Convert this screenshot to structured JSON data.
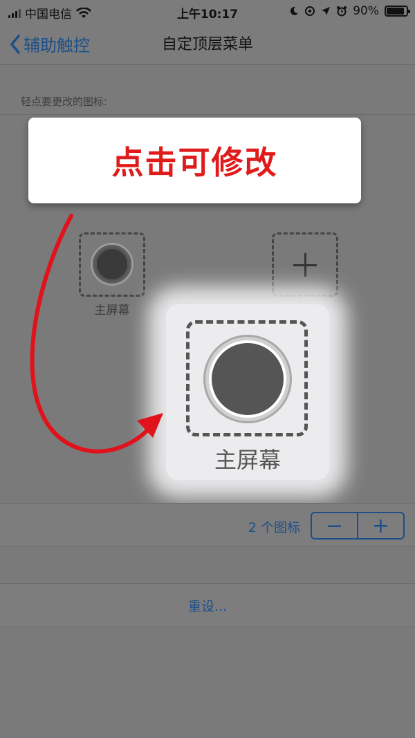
{
  "status_bar": {
    "carrier": "中国电信",
    "time": "上午10:17",
    "battery_percent": "90%",
    "battery_level": 0.9
  },
  "nav": {
    "back_label": "辅助触控",
    "title": "自定顶层菜单"
  },
  "section": {
    "label": "轻点要更改的图标:"
  },
  "callout": {
    "text": "点击可修改"
  },
  "icons": [
    {
      "label": "主屏幕",
      "icon": "home-button-icon"
    },
    {
      "label": "",
      "icon": "plus-icon"
    }
  ],
  "zoom": {
    "label": "主屏幕"
  },
  "count": {
    "text": "2 个图标",
    "minus": "−",
    "plus": "+"
  },
  "reset": {
    "label": "重设..."
  },
  "colors": {
    "accent": "#1c4f8a",
    "callout_text": "#e01b1b",
    "arrow": "#e0121b"
  }
}
